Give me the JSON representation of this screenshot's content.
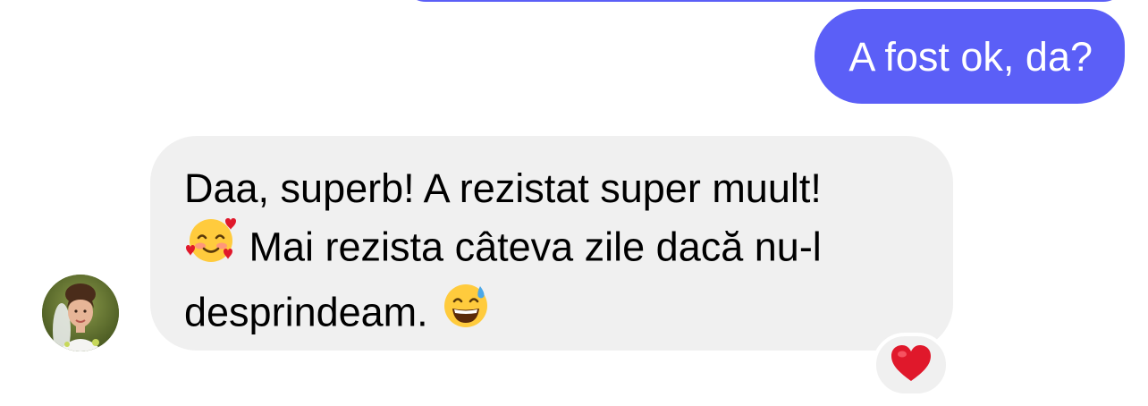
{
  "conversation": {
    "outgoing_message": "A fost ok, da?",
    "incoming_message": {
      "line1": "Daa, superb! A rezistat super muult!",
      "line2": "Mai rezista câteva zile dacă nu-l",
      "line3": "desprindeam."
    },
    "icons": {
      "emoji_1": "smiling-face-with-hearts-icon",
      "emoji_2": "grinning-face-with-sweat-icon",
      "reaction": "red-heart-icon",
      "avatar": "contact-avatar"
    }
  },
  "colors": {
    "outgoing_bubble": "#5b5ff7",
    "incoming_bubble": "#f0f0f0",
    "outgoing_text": "#ffffff",
    "incoming_text": "#000000",
    "heart": "#e0182b"
  }
}
